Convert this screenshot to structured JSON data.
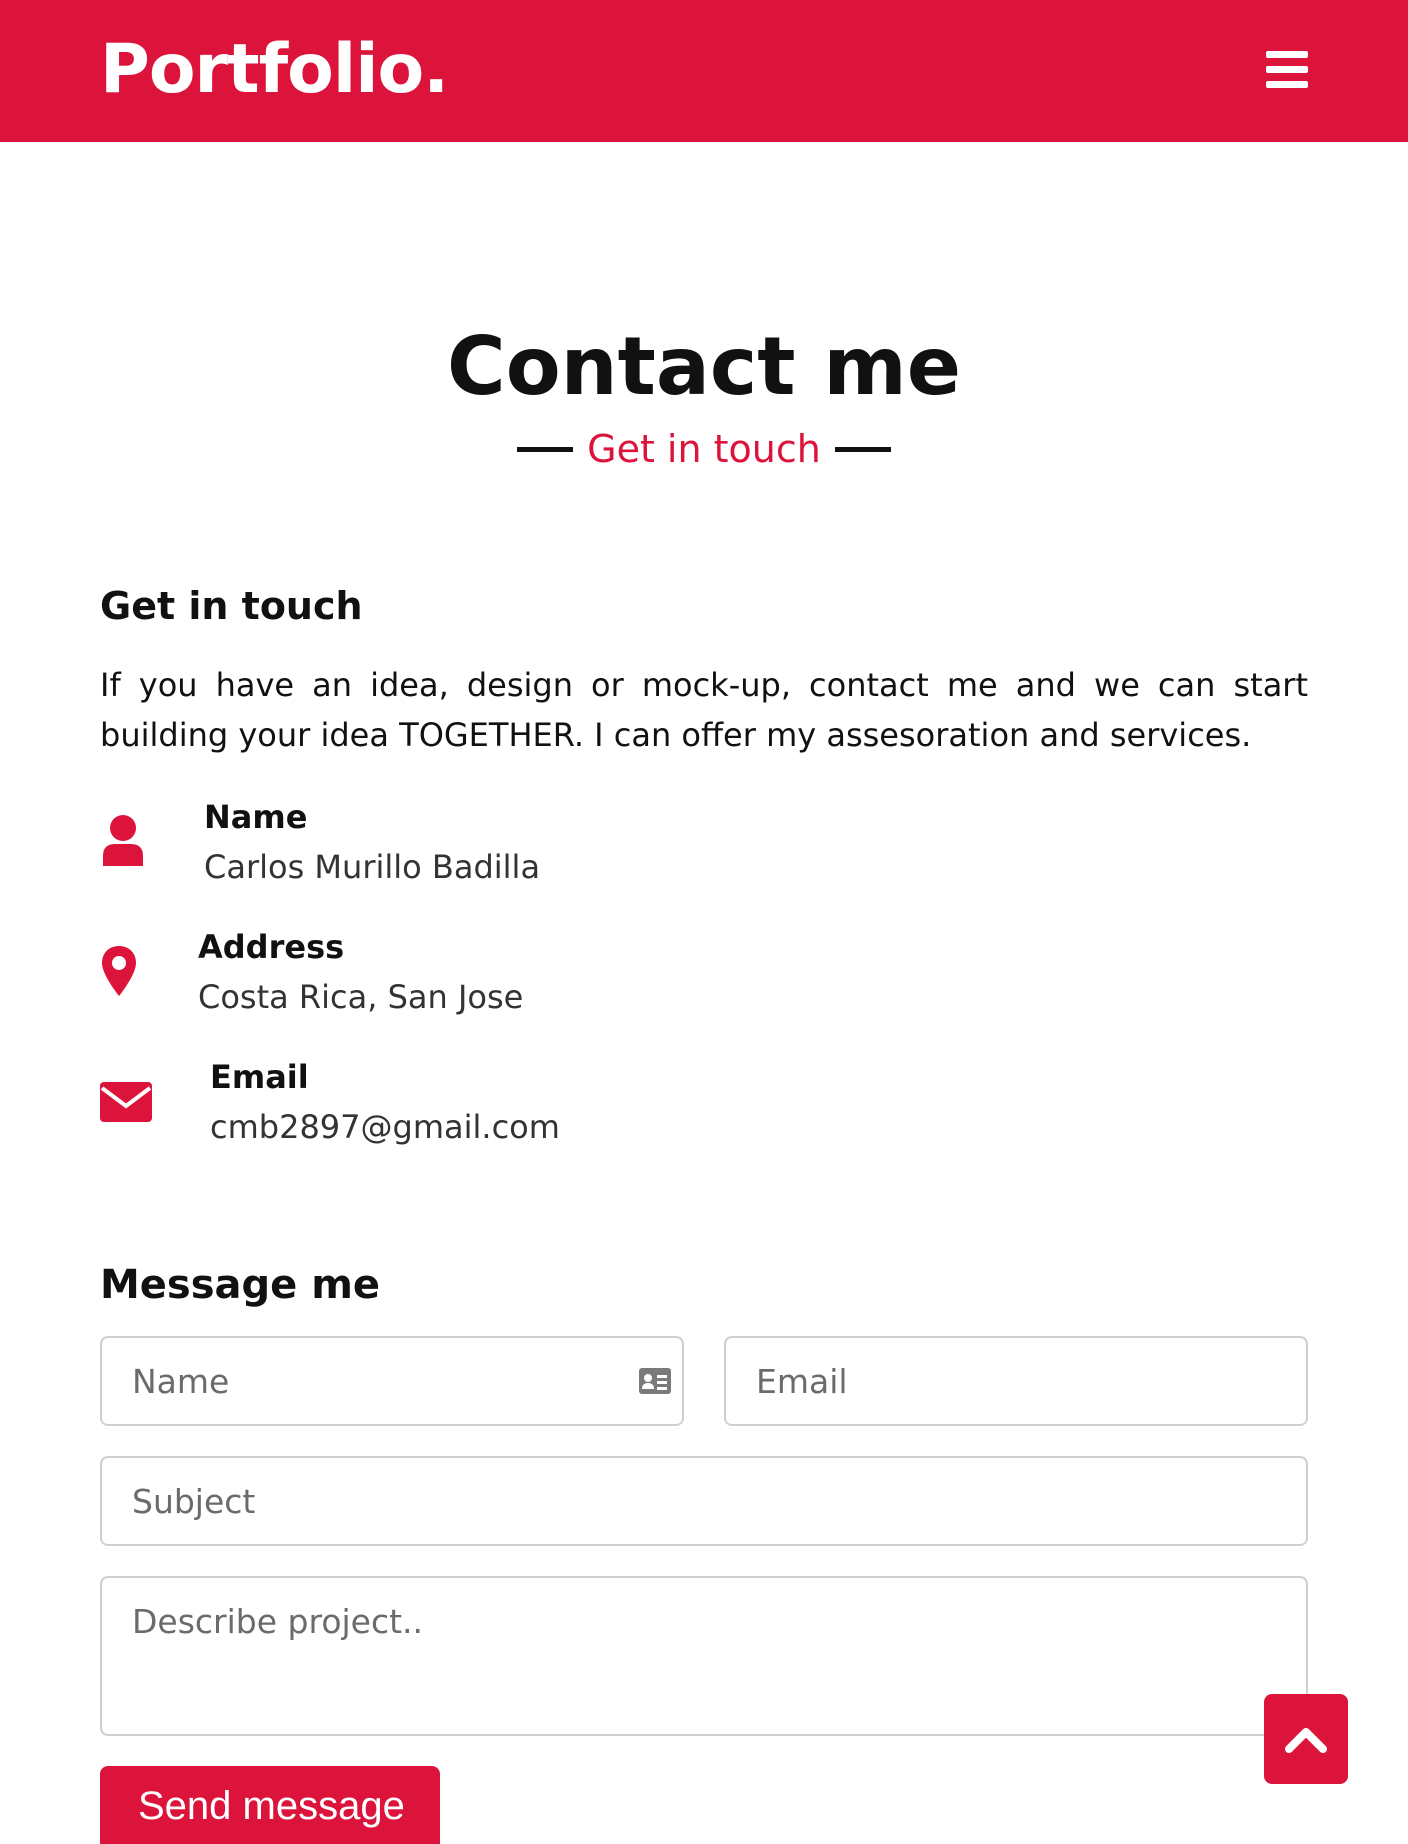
{
  "header": {
    "logo": "Portfolio.",
    "menu_icon": "hamburger-menu-icon",
    "background_color": "#dc143c"
  },
  "contact": {
    "title": "Contact me",
    "subtitle": "Get in touch"
  },
  "get_in_touch": {
    "heading": "Get in touch",
    "intro": "If you have an idea, design or mock-up, contact me and we can start building your idea TOGETHER. I can offer my assesoration and services.",
    "items": [
      {
        "icon": "user-icon",
        "label": "Name",
        "value": "Carlos Murillo Badilla"
      },
      {
        "icon": "map-marker-icon",
        "label": "Address",
        "value": "Costa Rica, San Jose"
      },
      {
        "icon": "envelope-icon",
        "label": "Email",
        "value": "cmb2897@gmail.com"
      }
    ]
  },
  "form": {
    "heading": "Message me",
    "name_placeholder": "Name",
    "email_placeholder": "Email",
    "subject_placeholder": "Subject",
    "message_placeholder": "Describe project..",
    "submit_label": "Send message"
  },
  "scroll_top": {
    "icon": "chevron-up-icon"
  },
  "accent_color": "#dc143c"
}
